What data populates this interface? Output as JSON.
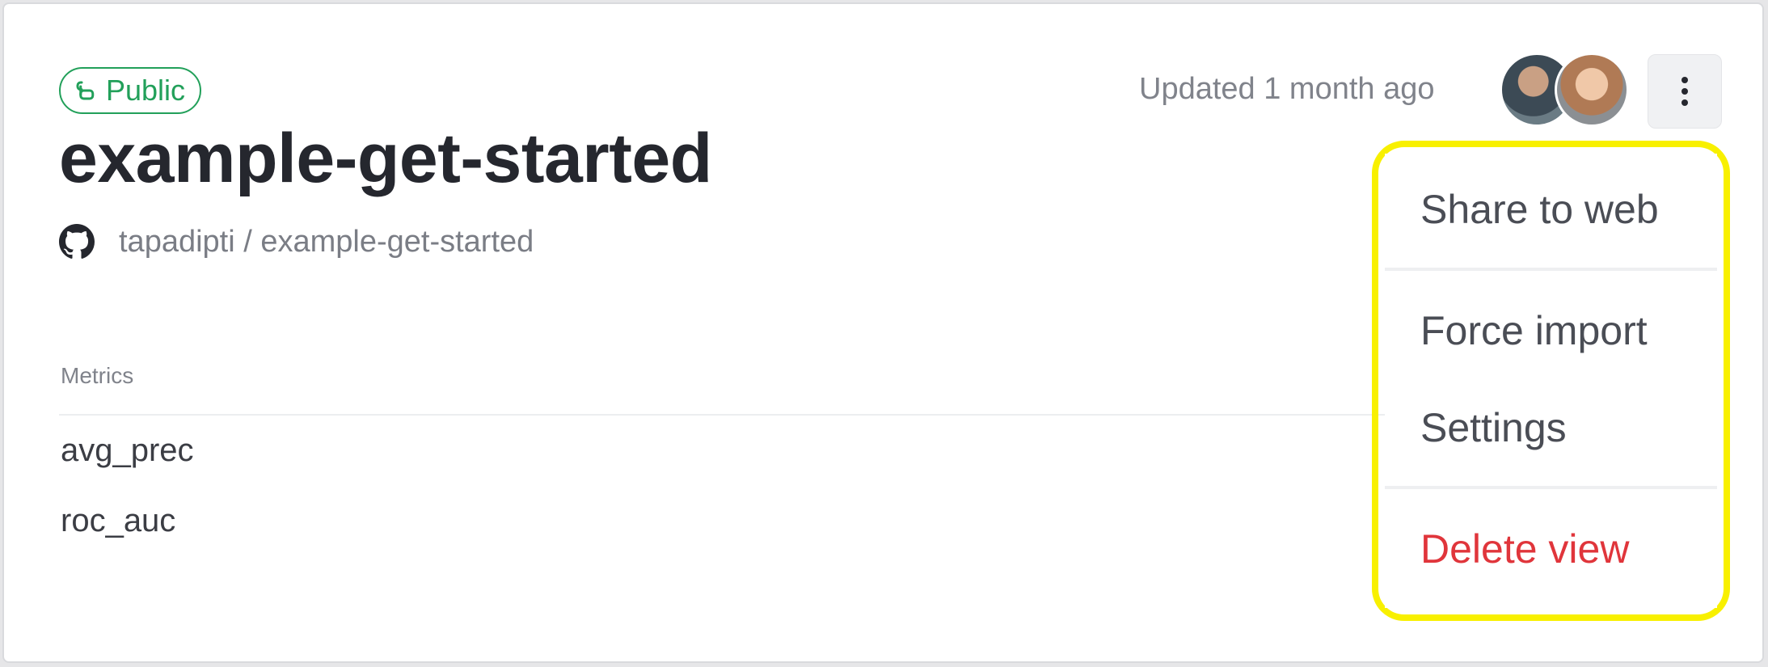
{
  "badge": {
    "label": "Public",
    "color": "#22a05a",
    "icon": "link-icon"
  },
  "title": "example-get-started",
  "repo": {
    "icon": "github-icon",
    "path": "tapadipti / example-get-started"
  },
  "metrics": {
    "header": "Metrics",
    "items": [
      "avg_prec",
      "roc_auc"
    ]
  },
  "header_right": {
    "updated": "Updated 1 month ago",
    "avatars": [
      "avatar-user-1",
      "avatar-user-2"
    ],
    "menu_button_icon": "kebab-vertical-icon"
  },
  "menu": {
    "share": "Share to web",
    "force_import": "Force import",
    "settings": "Settings",
    "delete": "Delete view",
    "delete_color": "#e0353b",
    "highlight_color": "#f8f000"
  }
}
